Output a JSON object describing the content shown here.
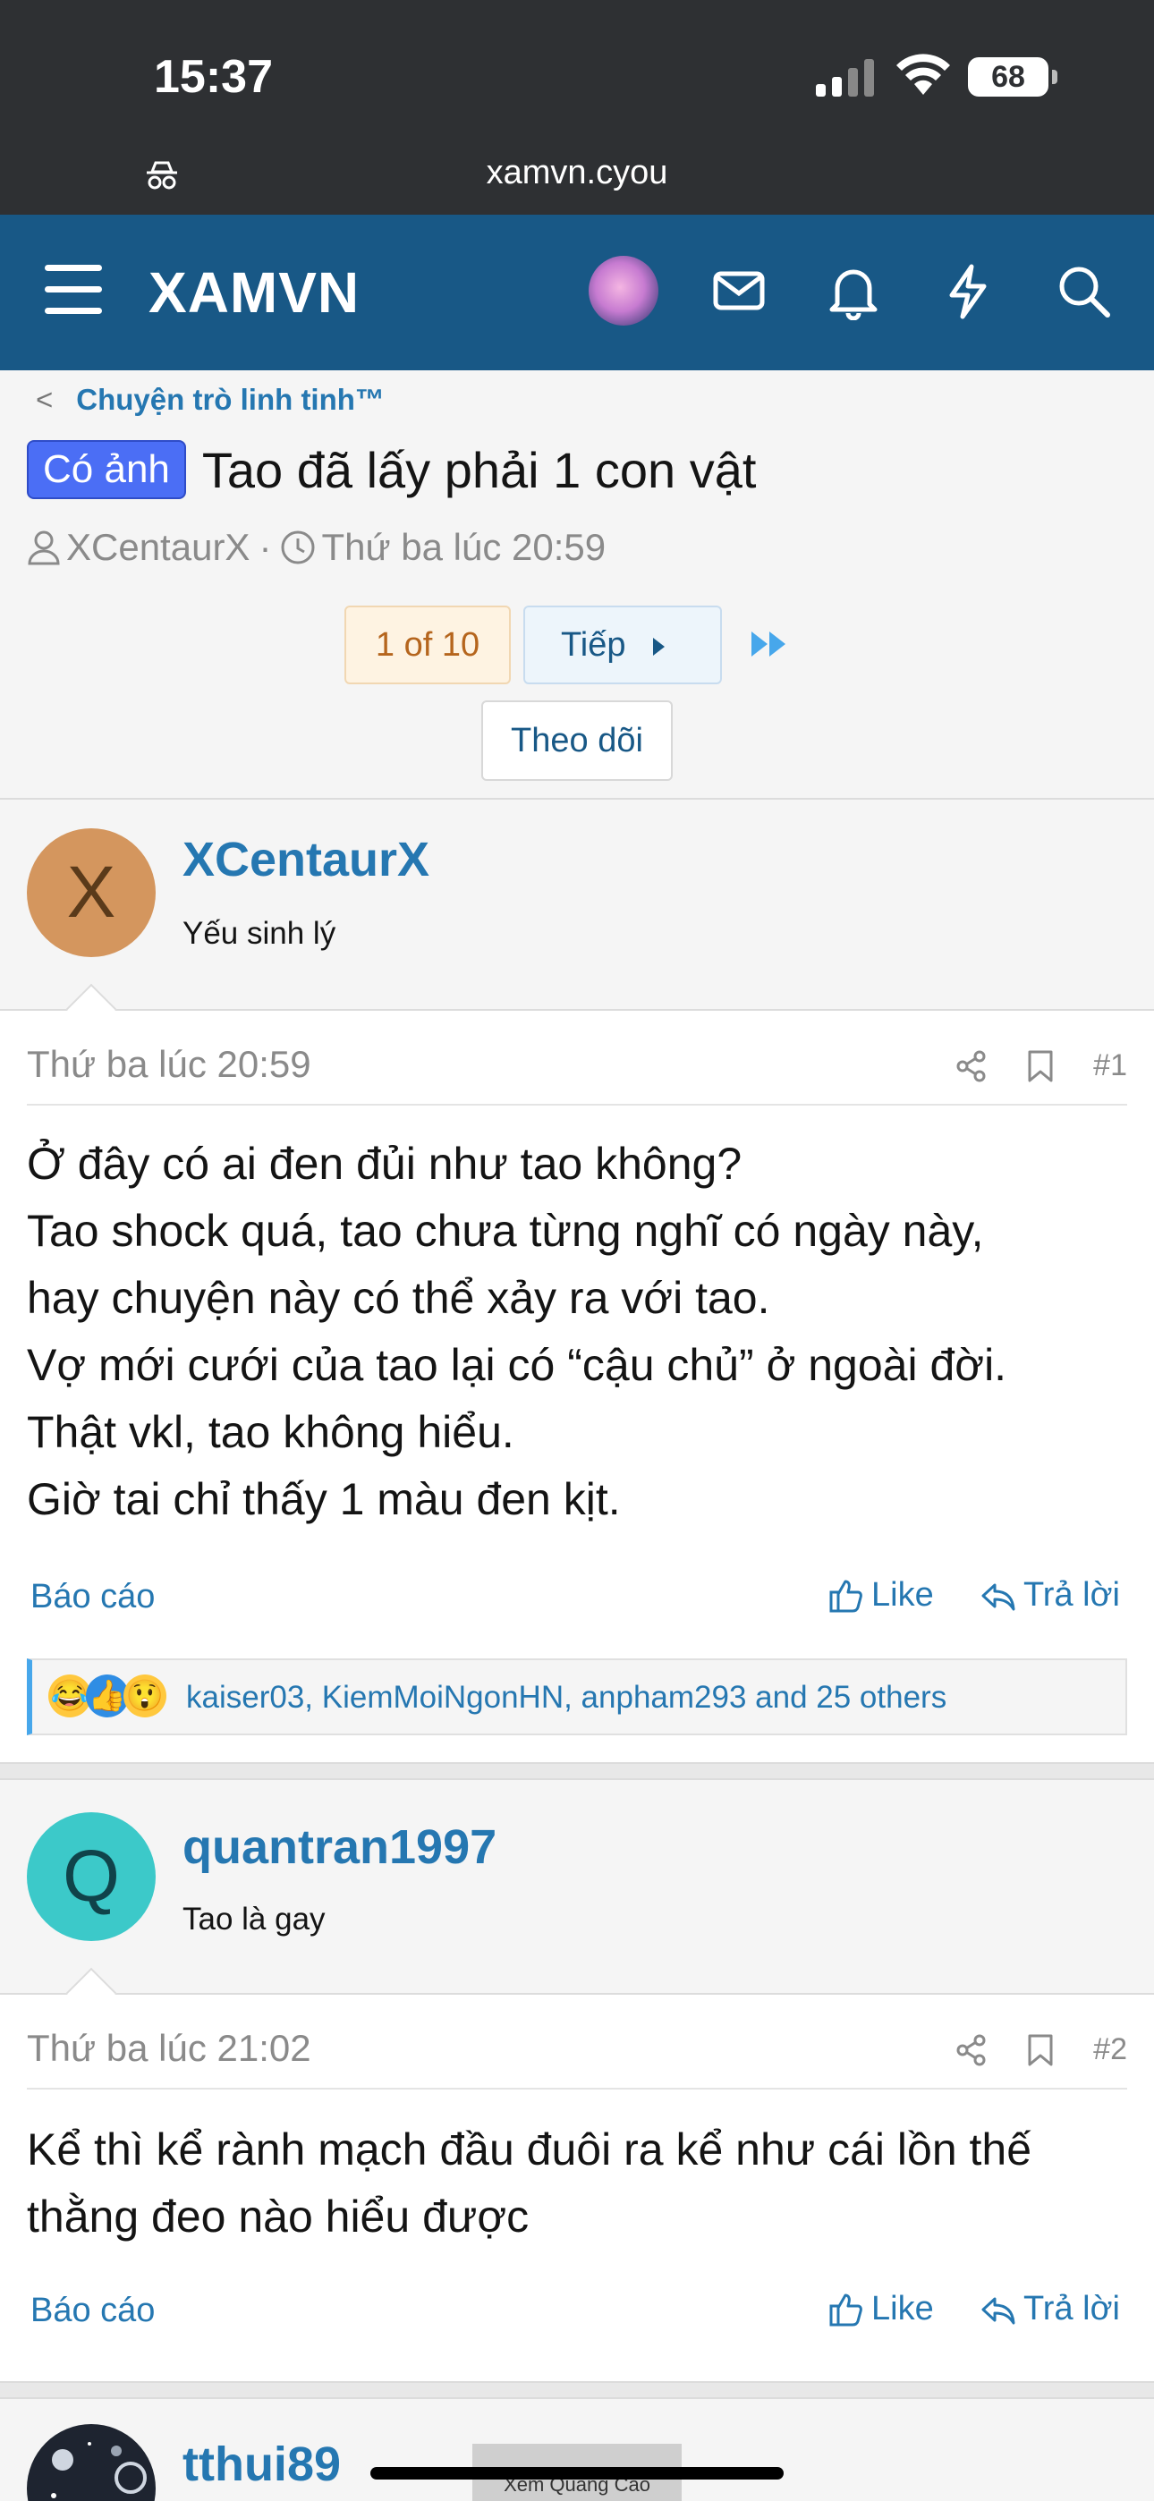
{
  "status_bar": {
    "time": "15:37",
    "battery": "68"
  },
  "browser": {
    "url": "xamvn.cyou"
  },
  "nav": {
    "brand": "XAMVN"
  },
  "thread": {
    "breadcrumb": "Chuyện trò linh tinh™",
    "prefix": "Có ảnh",
    "title": "Tao đã lấy phải 1 con vật",
    "author": "XCentaurX",
    "meta_sep": "·",
    "date": "Thứ ba lúc 20:59"
  },
  "pagination": {
    "current": "1 of 10",
    "next": "Tiếp"
  },
  "watch_label": "Theo dõi",
  "posts": [
    {
      "avatar_letter": "X",
      "avatar_color": "#d4965e",
      "avatar_text_color": "#5a3a1a",
      "username": "XCentaurX",
      "user_title": "Yếu sinh lý",
      "date": "Thứ ba lúc 20:59",
      "number": "#1",
      "lines": [
        "Ở đây có ai đen đủi như tao không?",
        "Tao shock quá, tao chưa từng nghĩ có ngày này,",
        "hay chuyện này có thể xảy ra với tao.",
        "Vợ mới cưới của tao lại có “cậu chủ” ở ngoài đời.",
        "Thật vkl, tao không hiểu.",
        "Giờ tai chỉ thấy 1 màu đen kịt."
      ],
      "report": "Báo cáo",
      "like": "Like",
      "reply": "Trả lời",
      "reactions": "kaiser03, KiemMoiNgonHN, anpham293 and 25 others"
    },
    {
      "avatar_letter": "Q",
      "avatar_color": "#3cc9c9",
      "avatar_text_color": "#10434a",
      "username": "quantran1997",
      "user_title": "Tao là gay",
      "date": "Thứ ba lúc 21:02",
      "number": "#2",
      "lines": [
        "Kể thì kể rành mạch đầu đuôi ra kể như cái lồn thế",
        "thằng đeo nào hiểu được"
      ],
      "report": "Báo cáo",
      "like": "Like",
      "reply": "Trả lời"
    },
    {
      "username": "tthui89"
    }
  ],
  "ad_label": "Xem Quảng Cáo",
  "icons": {
    "nav": [
      "menu-icon",
      "avatar",
      "mail-icon",
      "bell-icon",
      "bolt-icon",
      "search-icon"
    ],
    "post_tools": [
      "share-icon",
      "bookmark-icon"
    ],
    "actions": [
      "thumbs-up-icon",
      "reply-icon"
    ]
  },
  "colors": {
    "nav_bg": "#185886",
    "link": "#2577b1",
    "badge": "#4b6ef5"
  }
}
